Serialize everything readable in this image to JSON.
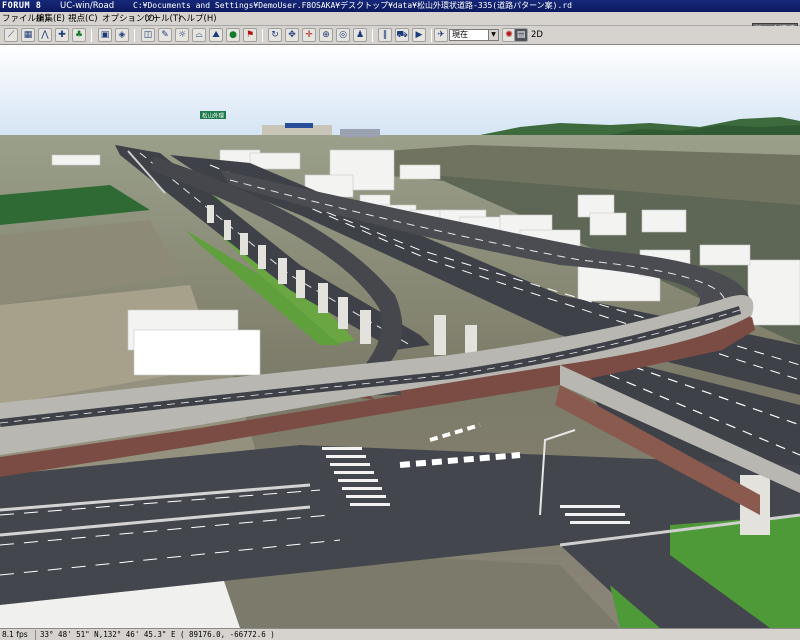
{
  "window": {
    "logo": "FORUM 8",
    "app_name": "UC-win/Road",
    "file_path": "C:¥Documents and Settings¥DemoUser.F8OSAKA¥デスクトップ¥data¥松山外環状道路-335(道路パターン案).rd",
    "corner_badge": "第４座標系"
  },
  "menu": [
    {
      "label": "ファイル(F)"
    },
    {
      "label": "編集(E)"
    },
    {
      "label": "視点(C)"
    },
    {
      "label": "オプション(O)"
    },
    {
      "label": "ツール(T)"
    },
    {
      "label": "ヘルプ(H)"
    }
  ],
  "toolbar": {
    "view_select_value": "現在",
    "mode_label": "2D",
    "icons": [
      "line-tool-icon",
      "map-icon",
      "road-icon",
      "intersection-icon",
      "tree-icon",
      "model-icon",
      "texture-icon",
      "camera-icon",
      "script-icon",
      "light-icon",
      "cross-section-icon",
      "terrain-icon",
      "vehicle-icon",
      "flag-icon",
      "rotate-icon",
      "pan-icon",
      "move-icon",
      "zoom-icon",
      "orbit-icon",
      "walk-icon",
      "pause-icon",
      "drive-icon",
      "play-icon",
      "record-icon",
      "fly-icon",
      "view-presets-icon",
      "sky-icon",
      "scene-icon"
    ]
  },
  "scene": {
    "road_sign_text": "松山外環",
    "sky_color": "#e2e8f5",
    "horizon_color": "#cfe1f3",
    "hill_color": "#3e6b3e",
    "ground_color": "#8c8a76",
    "asphalt_color": "#3f4148",
    "viaduct_color": "#b9b7b1",
    "girder_color": "#7b4c43",
    "grass_color": "#6aa642"
  },
  "status": {
    "fps": "8.1 fps",
    "coords": "33° 48' 51\" N,132° 46' 45.3\" E  ( 89176.0, -66772.6 )"
  }
}
